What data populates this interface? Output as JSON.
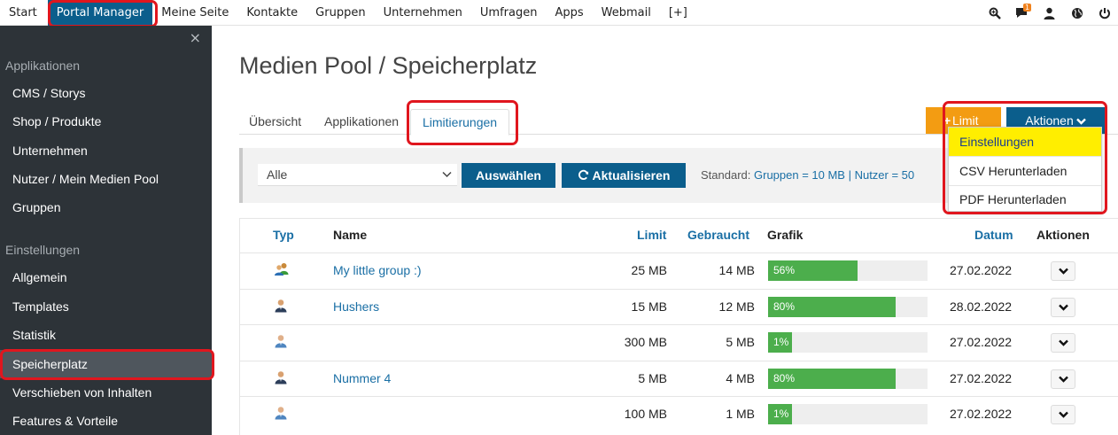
{
  "topbar": {
    "items": [
      "Start",
      "Portal Manager",
      "Meine Seite",
      "Kontakte",
      "Gruppen",
      "Unternehmen",
      "Umfragen",
      "Apps",
      "Webmail",
      "[+]"
    ],
    "active_index": 1,
    "icons": [
      "search-icon",
      "chat-icon",
      "user-icon",
      "globe-icon",
      "power-icon"
    ],
    "chat_badge": "1"
  },
  "sidebar": {
    "close": "×",
    "section_apps": "Applikationen",
    "apps": [
      "CMS / Storys",
      "Shop / Produkte",
      "Unternehmen",
      "Nutzer / Mein Medien Pool",
      "Gruppen"
    ],
    "section_settings": "Einstellungen",
    "settings": [
      "Allgemein",
      "Templates",
      "Statistik",
      "Speicherplatz",
      "Verschieben von Inhalten",
      "Features & Vorteile"
    ],
    "active_label": "Speicherplatz"
  },
  "main": {
    "title": "Medien Pool / Speicherplatz",
    "tabs": [
      "Übersicht",
      "Applikationen",
      "Limitierungen"
    ],
    "active_tab": "Limitierungen",
    "limit_button": "Limit",
    "aktionen_button": "Aktionen",
    "dropdown": [
      "Einstellungen",
      "CSV Herunterladen",
      "PDF Herunterladen"
    ],
    "filter": {
      "select_value": "Alle",
      "select_button": "Auswählen",
      "refresh_button": "Aktualisieren",
      "standard_prefix": "Standard:",
      "standard_value": "Gruppen = 10 MB | Nutzer = 50"
    },
    "table": {
      "headers": [
        "Typ",
        "Name",
        "Limit",
        "Gebraucht",
        "Grafik",
        "Datum",
        "Aktionen"
      ],
      "rows": [
        {
          "type": "group",
          "name": "My little group :)",
          "limit": "25 MB",
          "used": "14 MB",
          "percent": 56,
          "percent_label": "56%",
          "date": "27.02.2022"
        },
        {
          "type": "user",
          "name": "Hushers",
          "limit": "15 MB",
          "used": "12 MB",
          "percent": 80,
          "percent_label": "80%",
          "date": "28.02.2022"
        },
        {
          "type": "user-light",
          "name": "",
          "limit": "300 MB",
          "used": "5 MB",
          "percent": 1,
          "percent_label": "1%",
          "date": "27.02.2022"
        },
        {
          "type": "user",
          "name": "Nummer 4",
          "limit": "5 MB",
          "used": "4 MB",
          "percent": 80,
          "percent_label": "80%",
          "date": "27.02.2022"
        },
        {
          "type": "user-light",
          "name": "",
          "limit": "100 MB",
          "used": "1 MB",
          "percent": 1,
          "percent_label": "1%",
          "date": "27.02.2022"
        }
      ]
    }
  },
  "colors": {
    "primary": "#0b5e8c",
    "warning": "#f39c12",
    "success": "#4cae4c",
    "highlight": "#ffee00",
    "annotation": "#e0161e",
    "sidebar": "#2d3338"
  }
}
